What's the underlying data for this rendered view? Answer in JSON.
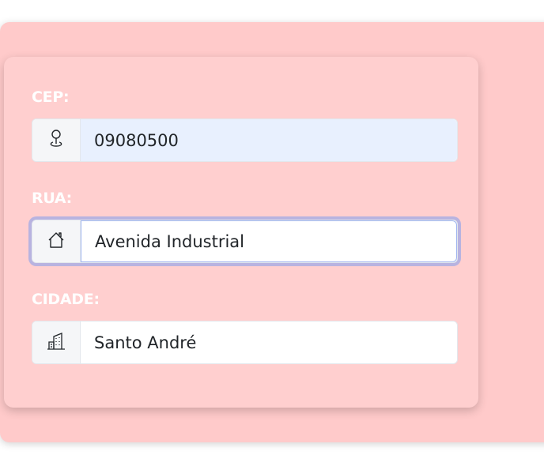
{
  "form": {
    "cep": {
      "label": "CEP:",
      "value": "09080500",
      "icon": "map-pin-icon"
    },
    "rua": {
      "label": "RUA:",
      "value": "Avenida Industrial",
      "icon": "house-icon"
    },
    "cidade": {
      "label": "CIDADE:",
      "value": "Santo André",
      "icon": "buildings-icon"
    }
  },
  "colors": {
    "panel_background": "#ffcaca",
    "card_background": "#ffcfcf",
    "label_color": "#ffffff",
    "autofill_background": "#e8f0fe",
    "focus_ring": "#a0aae6"
  }
}
